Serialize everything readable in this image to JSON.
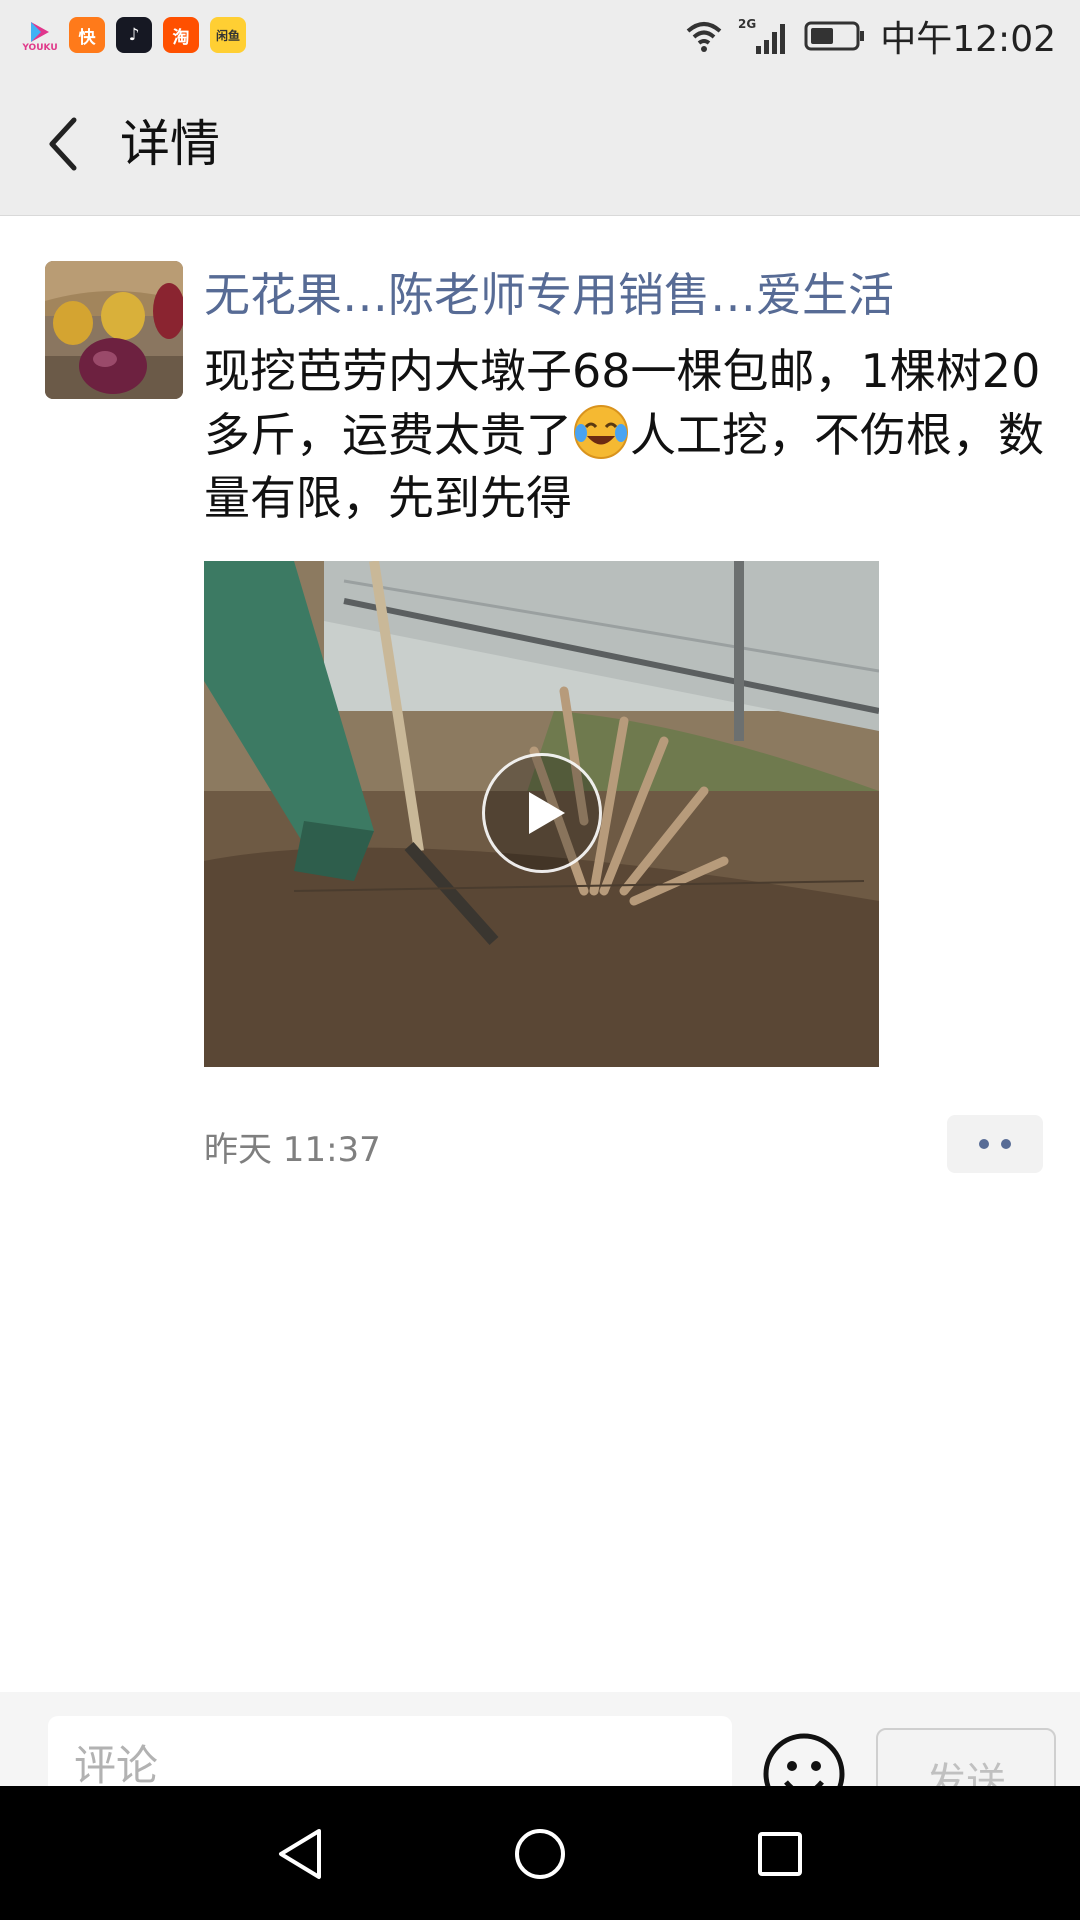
{
  "status_bar": {
    "apps": [
      {
        "icon": "youku-icon",
        "label": "YOUKU"
      },
      {
        "icon": "kuaishou-icon",
        "label": "快"
      },
      {
        "icon": "douyin-icon",
        "label": "♪"
      },
      {
        "icon": "taobao-icon",
        "label": "淘"
      },
      {
        "icon": "xianyu-icon",
        "label": "闲鱼"
      }
    ],
    "network": "2G",
    "time": "中午12:02"
  },
  "header": {
    "back_icon": "chevron-left-icon",
    "title": "详情"
  },
  "post": {
    "author": "无花果…陈老师专用销售…爱生活",
    "text_before_emoji": "现挖芭劳内大墩子68一棵包邮，1棵树20多斤，运费太贵了",
    "emoji": "face-with-tears-of-joy-icon",
    "text_after_emoji": "人工挖，不伤根，数量有限，先到先得",
    "video_icon": "play-icon",
    "time": "昨天 11:37",
    "more_icon": "more-dots-icon"
  },
  "comment": {
    "placeholder": "评论",
    "emoji_icon": "smiley-icon",
    "send_label": "发送"
  },
  "nav": {
    "back": "nav-back-icon",
    "home": "nav-home-icon",
    "recents": "nav-recents-icon"
  },
  "colors": {
    "bar_background": "#ededed",
    "author_link": "#576b95",
    "timestamp": "#7f7f7f"
  }
}
